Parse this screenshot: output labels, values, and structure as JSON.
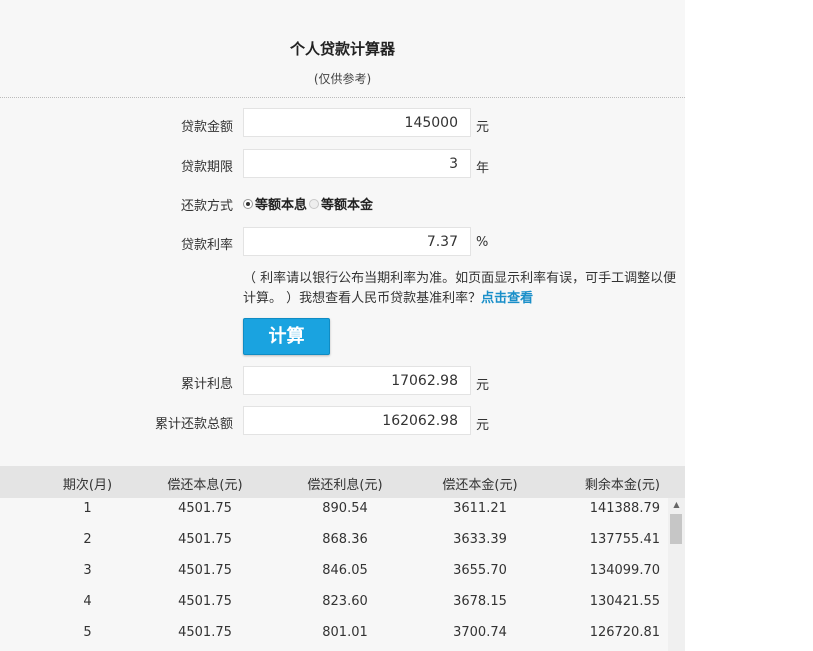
{
  "header": {
    "title": "个人贷款计算器",
    "subtitle": "(仅供参考)"
  },
  "form": {
    "amount": {
      "label": "贷款金额",
      "value": "145000",
      "unit": "元"
    },
    "term": {
      "label": "贷款期限",
      "value": "3",
      "unit": "年"
    },
    "method": {
      "label": "还款方式",
      "options": [
        "等额本息",
        "等额本金"
      ],
      "selected": "等额本息"
    },
    "rate": {
      "label": "贷款利率",
      "value": "7.37",
      "unit": "%"
    },
    "note_text": "（ 利率请以银行公布当期利率为准。如页面显示利率有误，可手工调整以便计算。 ）我想查看人民币贷款基准利率？",
    "note_link": "点击查看",
    "calc_button": "计算"
  },
  "results": {
    "total_interest": {
      "label": "累计利息",
      "value": "17062.98",
      "unit": "元"
    },
    "total_payment": {
      "label": "累计还款总额",
      "value": "162062.98",
      "unit": "元"
    }
  },
  "table": {
    "columns": [
      "期次(月)",
      "偿还本息(元)",
      "偿还利息(元)",
      "偿还本金(元)",
      "剩余本金(元)"
    ],
    "rows": [
      [
        "1",
        "4501.75",
        "890.54",
        "3611.21",
        "141388.79"
      ],
      [
        "2",
        "4501.75",
        "868.36",
        "3633.39",
        "137755.41"
      ],
      [
        "3",
        "4501.75",
        "846.05",
        "3655.70",
        "134099.70"
      ],
      [
        "4",
        "4501.75",
        "823.60",
        "3678.15",
        "130421.55"
      ],
      [
        "5",
        "4501.75",
        "801.01",
        "3700.74",
        "126720.81"
      ]
    ]
  },
  "colors": {
    "button": "#1aa3e0",
    "link": "#1a8fc9",
    "table_header": "#e4e4e4"
  }
}
